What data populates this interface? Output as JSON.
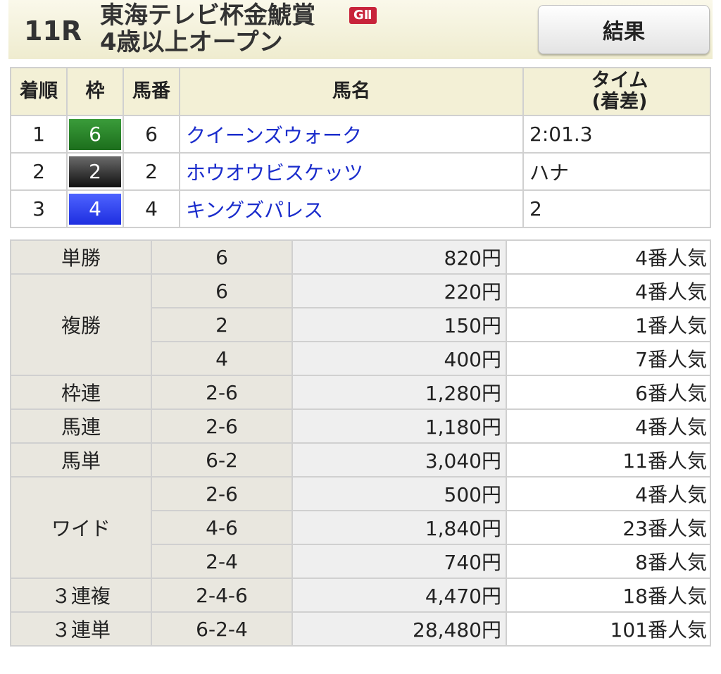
{
  "race": {
    "number": "11R",
    "name": "東海テレビ杯金鯱賞",
    "grade": "GⅡ",
    "condition": "4歳以上オープン",
    "result_button": "結果"
  },
  "results": {
    "headers": {
      "rank": "着順",
      "waku": "枠",
      "number": "馬番",
      "name": "馬名",
      "time": "タイム\n(着差)"
    },
    "rows": [
      {
        "rank": "1",
        "waku": "6",
        "waku_color": "#2a862a",
        "number": "6",
        "name": "クイーンズウォーク",
        "time": "2:01.3"
      },
      {
        "rank": "2",
        "waku": "2",
        "waku_color": "#333333",
        "number": "2",
        "name": "ホウオウビスケッツ",
        "time": "ハナ"
      },
      {
        "rank": "3",
        "waku": "4",
        "waku_color": "#2a3cf0",
        "number": "4",
        "name": "キングズパレス",
        "time": "2"
      }
    ]
  },
  "payouts": [
    {
      "type": "単勝",
      "entries": [
        {
          "combo": "6",
          "amount": "820円",
          "popularity": "4番人気"
        }
      ]
    },
    {
      "type": "複勝",
      "entries": [
        {
          "combo": "6",
          "amount": "220円",
          "popularity": "4番人気"
        },
        {
          "combo": "2",
          "amount": "150円",
          "popularity": "1番人気"
        },
        {
          "combo": "4",
          "amount": "400円",
          "popularity": "7番人気"
        }
      ]
    },
    {
      "type": "枠連",
      "entries": [
        {
          "combo": "2-6",
          "amount": "1,280円",
          "popularity": "6番人気"
        }
      ]
    },
    {
      "type": "馬連",
      "entries": [
        {
          "combo": "2-6",
          "amount": "1,180円",
          "popularity": "4番人気"
        }
      ]
    },
    {
      "type": "馬単",
      "entries": [
        {
          "combo": "6-2",
          "amount": "3,040円",
          "popularity": "11番人気"
        }
      ]
    },
    {
      "type": "ワイド",
      "entries": [
        {
          "combo": "2-6",
          "amount": "500円",
          "popularity": "4番人気"
        },
        {
          "combo": "4-6",
          "amount": "1,840円",
          "popularity": "23番人気"
        },
        {
          "combo": "2-4",
          "amount": "740円",
          "popularity": "8番人気"
        }
      ]
    },
    {
      "type": "３連複",
      "entries": [
        {
          "combo": "2-4-6",
          "amount": "4,470円",
          "popularity": "18番人気"
        }
      ]
    },
    {
      "type": "３連単",
      "entries": [
        {
          "combo": "6-2-4",
          "amount": "28,480円",
          "popularity": "101番人気"
        }
      ]
    }
  ]
}
